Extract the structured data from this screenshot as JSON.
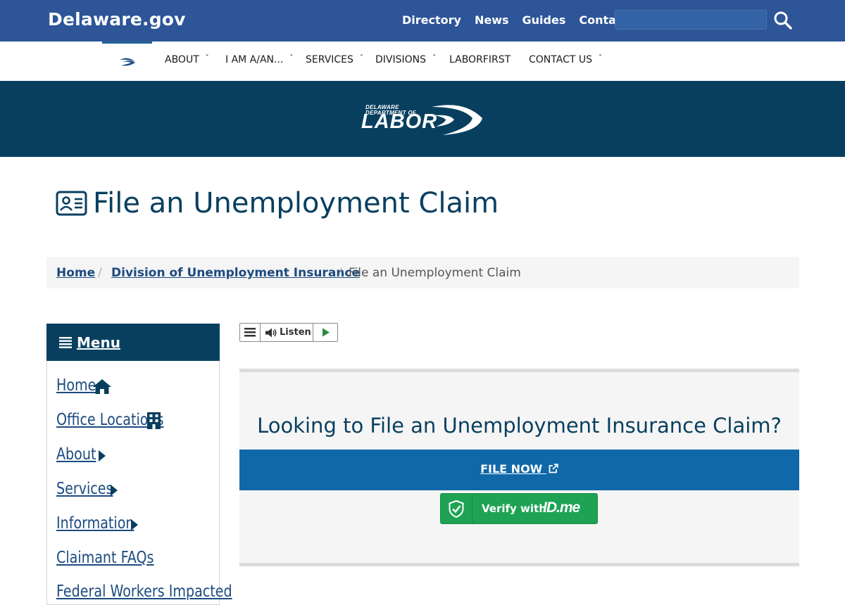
{
  "header": {
    "brand": "Delaware.gov",
    "links": [
      "Directory",
      "News",
      "Guides",
      "Contact"
    ],
    "search": {
      "placeholder": ""
    }
  },
  "nav": {
    "items": [
      {
        "label": "ABOUT",
        "has_dropdown": true
      },
      {
        "label": "I AM A/AN...",
        "has_dropdown": true
      },
      {
        "label": "SERVICES",
        "has_dropdown": true
      },
      {
        "label": "DIVISIONS",
        "has_dropdown": true
      },
      {
        "label": "LABORFIRST",
        "has_dropdown": false
      },
      {
        "label": "CONTACT US",
        "has_dropdown": true
      }
    ],
    "chevron": "˅"
  },
  "banner": {
    "logo_line1": "DELAWARE",
    "logo_line2": "DEPARTMENT OF",
    "logo_word": "LABOR"
  },
  "page": {
    "title": "File an Unemployment Claim"
  },
  "breadcrumb": {
    "items": [
      "Home",
      "Division of Unemployment Insurance",
      "File an Unemployment Claim"
    ],
    "separator": "/"
  },
  "sidebar": {
    "menu_label": "Menu",
    "items": [
      {
        "label": "Home",
        "icon": "home-icon"
      },
      {
        "label": "Office Locations",
        "icon": "building-icon"
      },
      {
        "label": "About",
        "icon": "caret-right-icon"
      },
      {
        "label": "Services",
        "icon": "caret-right-icon"
      },
      {
        "label": "Information",
        "icon": "caret-right-icon"
      },
      {
        "label": "Claimant FAQs",
        "icon": ""
      },
      {
        "label": "Federal Workers Impacted",
        "icon": ""
      }
    ]
  },
  "listen": {
    "label": "Listen"
  },
  "callout": {
    "title": "Looking to File an Unemployment Insurance Claim?",
    "file_button": "FILE NOW",
    "idme_text": "Verify with",
    "idme_brand": "ID.me"
  },
  "colors": {
    "header_blue": "#2d5597",
    "banner_navy": "#083f5f",
    "link_blue": "#1c4b80",
    "file_bar": "#1068a8",
    "idme_green": "#1ea354"
  }
}
